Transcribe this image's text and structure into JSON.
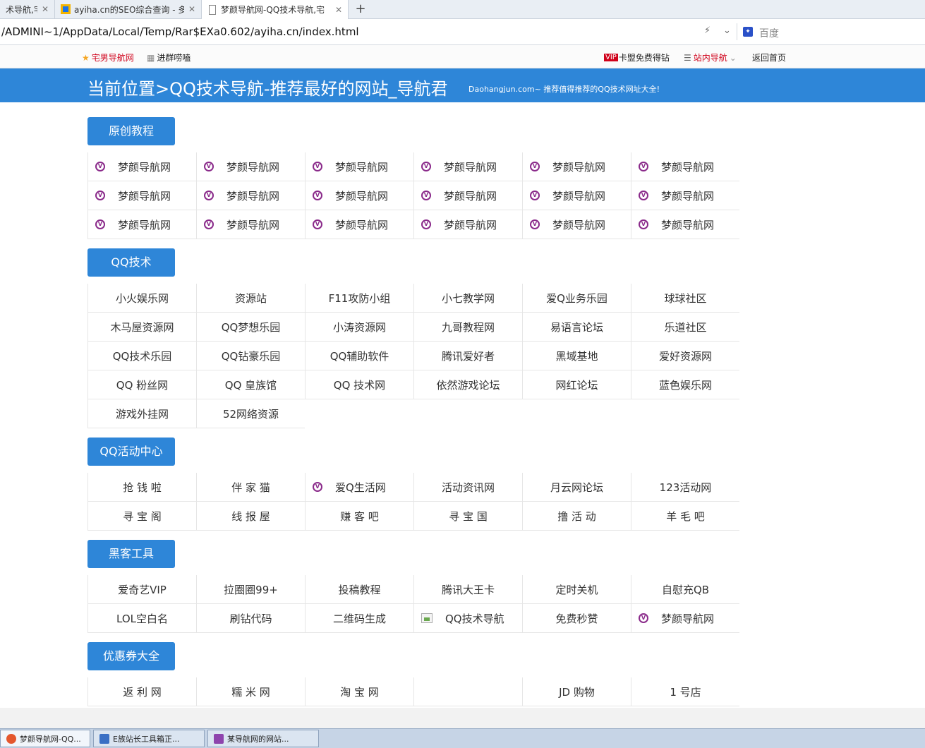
{
  "browser": {
    "tabs": [
      {
        "title": "术导航,宅",
        "active": false
      },
      {
        "title": "ayiha.cn的SEO综合查询 - 多",
        "active": false
      },
      {
        "title": "梦颜导航网-QQ技术导航,宅",
        "active": true
      }
    ],
    "new_tab": "+",
    "url": "/ADMINI~1/AppData/Local/Temp/Rar$EXa0.602/ayiha.cn/index.html",
    "search_placeholder": "百度",
    "favorites_left": [
      {
        "label": "宅男导航网",
        "icon": "star-icon"
      },
      {
        "label": "进群唠嗑",
        "icon": "grid-icon"
      }
    ],
    "favorites_right": [
      {
        "label": "卡盟免费得钻",
        "icon": "vip-icon",
        "badge": "VIP"
      },
      {
        "label": "站内导航",
        "icon": "list-icon"
      },
      {
        "label": "返回首页",
        "icon": ""
      }
    ]
  },
  "banner": {
    "title": "当前位置>QQ技术导航-推荐最好的网站_导航君",
    "subtitle": "Daohangjun.com~ 推荐值得推荐的QQ技术网址大全!"
  },
  "sections": [
    {
      "name": "原创教程",
      "items": [
        "梦颜导航网",
        "梦颜导航网",
        "梦颜导航网",
        "梦颜导航网",
        "梦颜导航网",
        "梦颜导航网",
        "梦颜导航网",
        "梦颜导航网",
        "梦颜导航网",
        "梦颜导航网",
        "梦颜导航网",
        "梦颜导航网",
        "梦颜导航网",
        "梦颜导航网",
        "梦颜导航网",
        "梦颜导航网",
        "梦颜导航网",
        "梦颜导航网"
      ]
    },
    {
      "name": "QQ技术",
      "items": [
        "小火娱乐网",
        "资源站",
        "F11攻防小组",
        "小七教学网",
        "爱Q业务乐园",
        "球球社区",
        "木马屋资源网",
        "QQ梦想乐园",
        "小涛资源网",
        "九哥教程网",
        "易语言论坛",
        "乐道社区",
        "QQ技术乐园",
        "QQ钻豪乐园",
        "QQ辅助软件",
        "腾讯爱好者",
        "黑域基地",
        "爱好资源网",
        "QQ 粉丝网",
        "QQ 皇族馆",
        "QQ 技术网",
        "依然游戏论坛",
        "网红论坛",
        "蓝色娱乐网",
        "游戏外挂网",
        "52网络资源"
      ]
    },
    {
      "name": "QQ活动中心",
      "items": [
        "抢 钱 啦",
        "伴 家 猫",
        "爱Q生活网",
        "活动资讯网",
        "月云网论坛",
        "123活动网",
        "寻 宝 阁",
        "线 报 屋",
        "赚 客 吧",
        "寻 宝 国",
        "撸 活 动",
        "羊 毛 吧"
      ]
    },
    {
      "name": "黑客工具",
      "items": [
        "爱奇艺VIP",
        "拉圈圈99+",
        "投稿教程",
        "腾讯大王卡",
        "定时关机",
        "自慰充QB",
        "LOL空白名",
        "刷钻代码",
        "二维码生成",
        "QQ技术导航",
        "免费秒赞",
        "梦颜导航网"
      ]
    },
    {
      "name": "优惠券大全",
      "items": [
        "返 利 网",
        "糯 米 网",
        "淘 宝 网",
        "",
        "JD 购物",
        "1 号店"
      ]
    }
  ],
  "taskbar": {
    "items": [
      {
        "label": "梦颜导航网-QQ...",
        "active": true
      },
      {
        "label": "E族站长工具箱正...",
        "active": false
      },
      {
        "label": "某导航网的网站...",
        "active": false
      }
    ]
  },
  "colors": {
    "accent": "#2e86d8",
    "icon_purple": "#8a2a8a",
    "fav_red": "#d0021b"
  }
}
